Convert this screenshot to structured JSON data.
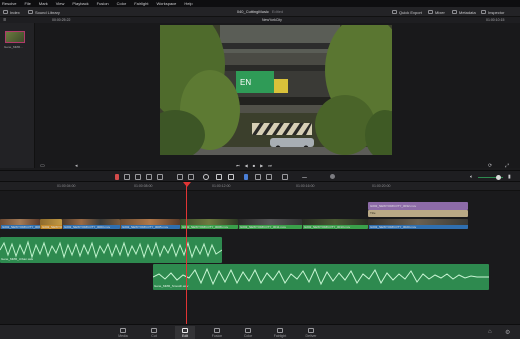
{
  "menu": [
    "Resolve",
    "File",
    "Mark",
    "View",
    "Playback",
    "Fusion",
    "Color",
    "Fairlight",
    "Workspace",
    "Help"
  ],
  "toolbar": {
    "media_pool": "Index",
    "sound_library": "Sound Library",
    "project_title": "040_CuttingMusic",
    "edited": "Edited",
    "quick_export": "Quick Export",
    "mixer": "Mixer",
    "metadata": "Metadata",
    "inspector": "Inspector"
  },
  "info": {
    "timecode_left": "00:00:25:22",
    "timeline_name": "NewYorkCity",
    "timecode_right": "01:00:10:15"
  },
  "media_pool": {
    "clip_name": "Gene_MMR..."
  },
  "ruler": [
    "01:00:04:00",
    "01:00:08:00",
    "01:00:12:00",
    "01:00:16:00",
    "01:00:20:00"
  ],
  "video_clips": [
    "G002_NEWYORKCITY_0001.mov",
    "G002_NEWYORKCITY_0002.mov",
    "G002_NEWYORKCITY_0003.mov",
    "G002_NEWYORKCITY_0005.mov",
    "G002_NEWYORKCITY_0008.mov",
    "G002_NEWYORKCITY_0011.mov",
    "G002_NEWYORKCITY_0013.mov",
    "G002_NEWYORKCITY_0020.mov",
    "G002_NEWYORKCITY_0030.mov"
  ],
  "upper_clips": [
    "G002_NEWYORKCITY_0032.mov",
    "Title"
  ],
  "audio_clips": [
    "Gene_MMR_Urban.wav",
    "Gene_MMR_Smooth.wav"
  ],
  "pages": [
    "Media",
    "Cut",
    "Edit",
    "Fusion",
    "Color",
    "Fairlight",
    "Deliver"
  ]
}
